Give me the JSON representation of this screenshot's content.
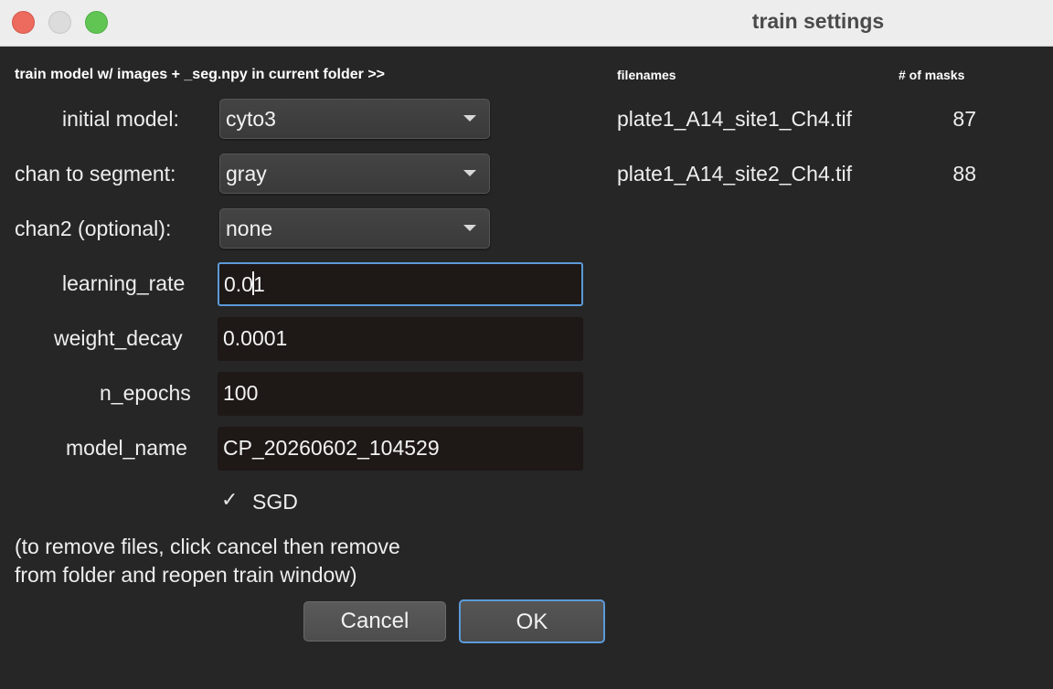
{
  "window": {
    "title": "train settings"
  },
  "header": {
    "instruction": "train model w/ images + _seg.npy in current folder >>"
  },
  "form": {
    "initial_model": {
      "label": "initial model:",
      "value": "cyto3"
    },
    "chan_to_segment": {
      "label": "chan to segment:",
      "value": "gray"
    },
    "chan2": {
      "label": "chan2 (optional):",
      "value": "none"
    },
    "learning_rate": {
      "label": "learning_rate",
      "value_before_cursor": "0.0",
      "value_after_cursor": "1"
    },
    "weight_decay": {
      "label": "weight_decay",
      "value": "0.0001"
    },
    "n_epochs": {
      "label": "n_epochs",
      "value": "100"
    },
    "model_name": {
      "label": "model_name",
      "value": "CP_20260602_104529"
    },
    "sgd": {
      "label": "SGD",
      "checked": true,
      "check_glyph": "✓"
    }
  },
  "note": {
    "line1": "(to remove files, click cancel then remove",
    "line2": "from folder and reopen train window)"
  },
  "buttons": {
    "cancel": "Cancel",
    "ok": "OK"
  },
  "file_table": {
    "col_filenames": "filenames",
    "col_masks": "# of masks",
    "rows": [
      {
        "name": "plate1_A14_site1_Ch4.tif",
        "masks": "87"
      },
      {
        "name": "plate1_A14_site2_Ch4.tif",
        "masks": "88"
      }
    ]
  },
  "colors": {
    "background": "#262626",
    "focus_accent": "#5b9ad8",
    "field_bg": "#1e1816"
  }
}
